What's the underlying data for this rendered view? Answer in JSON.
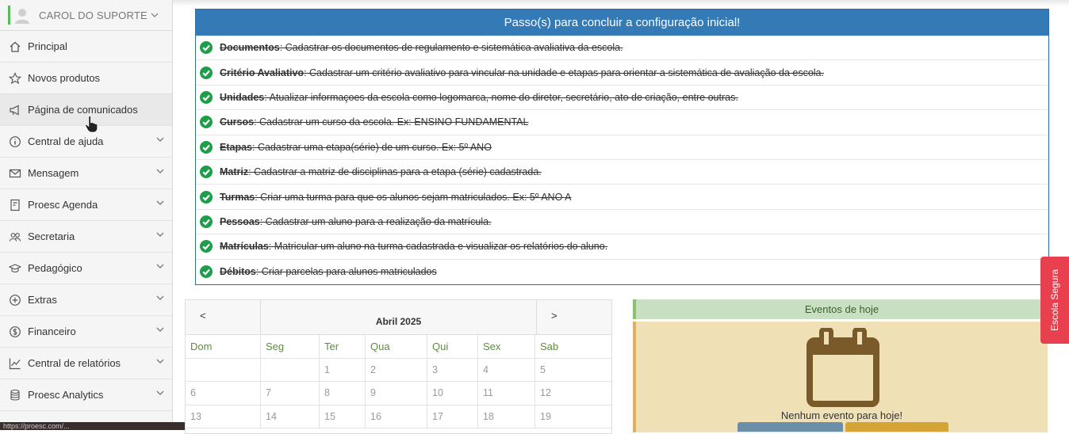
{
  "user": {
    "name": "CAROL DO SUPORTE"
  },
  "sidebar": {
    "items": [
      {
        "label": "Principal",
        "icon": "home-icon",
        "has_chevron": false
      },
      {
        "label": "Novos produtos",
        "icon": "star-icon",
        "has_chevron": false
      },
      {
        "label": "Página de comunicados",
        "icon": "megaphone-icon",
        "has_chevron": false
      },
      {
        "label": "Central de ajuda",
        "icon": "info-icon",
        "has_chevron": true
      },
      {
        "label": "Mensagem",
        "icon": "envelope-icon",
        "has_chevron": true
      },
      {
        "label": "Proesc Agenda",
        "icon": "agenda-icon",
        "has_chevron": true
      },
      {
        "label": "Secretaria",
        "icon": "users-icon",
        "has_chevron": true
      },
      {
        "label": "Pedagógico",
        "icon": "graduation-cap-icon",
        "has_chevron": true
      },
      {
        "label": "Extras",
        "icon": "plus-circle-icon",
        "has_chevron": true
      },
      {
        "label": "Financeiro",
        "icon": "dollar-icon",
        "has_chevron": true
      },
      {
        "label": "Central de relatórios",
        "icon": "line-chart-icon",
        "has_chevron": true
      },
      {
        "label": "Proesc Analytics",
        "icon": "database-icon",
        "has_chevron": true
      }
    ]
  },
  "setup": {
    "title": "Passo(s) para concluir a configuração inicial!",
    "steps": [
      {
        "name": "Documentos",
        "desc": ": Cadastrar os documentos de regulamento e sistemática avaliativa da escola."
      },
      {
        "name": "Critério Avaliativo",
        "desc": ": Cadastrar um critério avaliativo para vincular na unidade e etapas para orientar a sistemática de avaliação da escola."
      },
      {
        "name": "Unidades",
        "desc": ": Atualizar informaçoes da escola como logomarca, nome do diretor, secretário, ato de criação, entre outras."
      },
      {
        "name": "Cursos",
        "desc": ": Cadastrar um curso da escola. Ex: ENSINO FUNDAMENTAL"
      },
      {
        "name": "Etapas",
        "desc": ": Cadastrar uma etapa(série) de um curso. Ex: 5º ANO"
      },
      {
        "name": "Matriz",
        "desc": ": Cadastrar a matriz de disciplinas para a etapa (série) cadastrada."
      },
      {
        "name": "Turmas",
        "desc": ": Criar uma turma para que os alunos sejam matriculados. Ex: 5º ANO A"
      },
      {
        "name": "Pessoas",
        "desc": ": Cadastrar um aluno para a realização da matrícula."
      },
      {
        "name": "Matrículas",
        "desc": ": Matricular um aluno na turma cadastrada e visualizar os relatórios do aluno."
      },
      {
        "name": "Débitos",
        "desc": ": Criar parcelas para alunos matriculados"
      }
    ]
  },
  "calendar": {
    "prev": "<",
    "next": ">",
    "month": "Abril 2025",
    "weekdays": [
      "Dom",
      "Seg",
      "Ter",
      "Qua",
      "Qui",
      "Sex",
      "Sab"
    ],
    "weeks": [
      [
        "",
        "",
        "1",
        "2",
        "3",
        "4",
        "5"
      ],
      [
        "6",
        "7",
        "8",
        "9",
        "10",
        "11",
        "12"
      ],
      [
        "13",
        "14",
        "15",
        "16",
        "17",
        "18",
        "19"
      ]
    ]
  },
  "events": {
    "title": "Eventos de hoje",
    "empty": "Nenhum evento para hoje!"
  },
  "side_tab": {
    "label": "Escola Segura"
  },
  "status_url": "https://proesc.com/..."
}
